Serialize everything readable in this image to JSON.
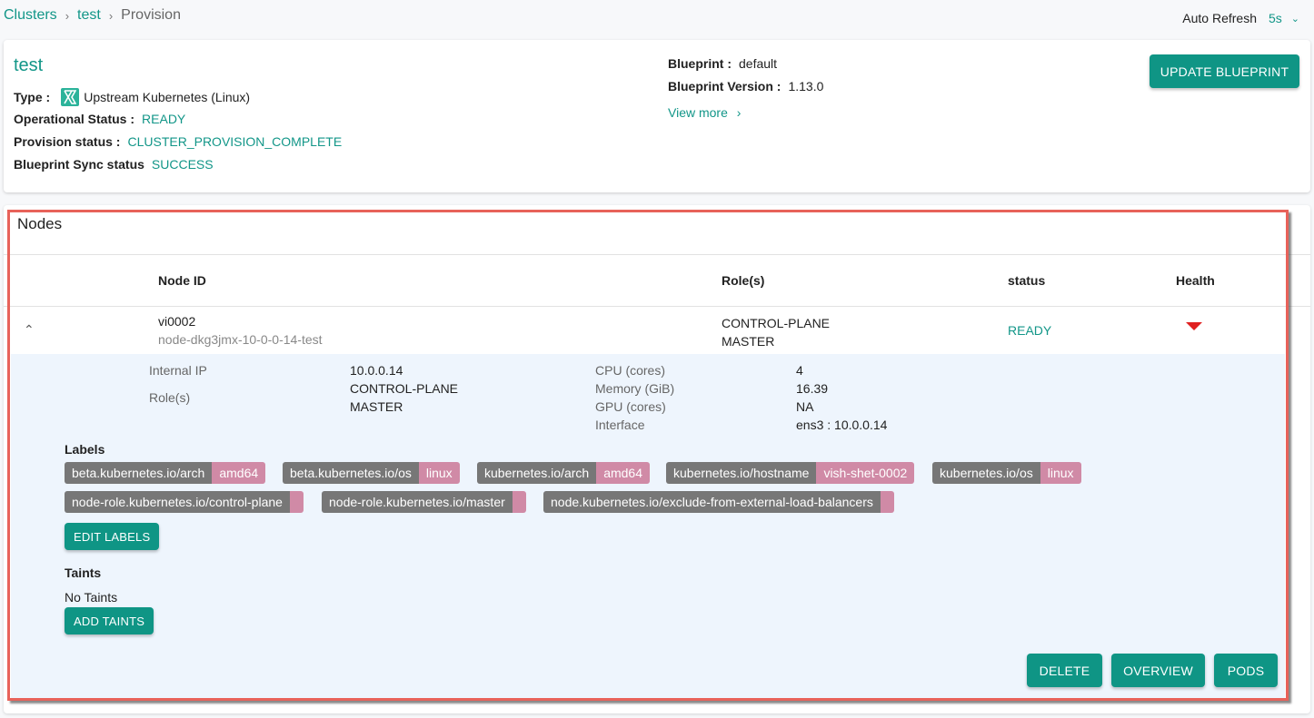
{
  "breadcrumb": [
    {
      "label": "Clusters",
      "link": true
    },
    {
      "label": "test",
      "link": true
    },
    {
      "label": "Provision",
      "link": false
    }
  ],
  "breadcrumb_separator": "›",
  "auto_refresh": {
    "label": "Auto Refresh",
    "value": "5s"
  },
  "cluster": {
    "name": "test",
    "type_label": "Type :",
    "type_value": "Upstream Kubernetes (Linux)",
    "operational_label": "Operational Status :",
    "operational_value": "READY",
    "provision_label": "Provision status :",
    "provision_value": "CLUSTER_PROVISION_COMPLETE",
    "sync_label": "Blueprint Sync status",
    "sync_value": "SUCCESS",
    "blueprint_label": "Blueprint :",
    "blueprint_value": "default",
    "blueprint_version_label": "Blueprint Version :",
    "blueprint_version_value": "1.13.0",
    "view_more": "View more",
    "update_button": "UPDATE BLUEPRINT"
  },
  "nodes": {
    "title": "Nodes",
    "columns": [
      "Node ID",
      "Role(s)",
      "status",
      "Health"
    ],
    "rows": [
      {
        "name": "vi0002",
        "id": "node-dkg3jmx-10-0-0-14-test",
        "roles": [
          "CONTROL-PLANE",
          "MASTER"
        ],
        "status": "READY",
        "health": "down"
      }
    ],
    "detail": {
      "internal_ip_label": "Internal IP",
      "internal_ip": "10.0.0.14",
      "roles_label": "Role(s)",
      "roles": [
        "CONTROL-PLANE",
        "MASTER"
      ],
      "cpu_label": "CPU (cores)",
      "cpu": "4",
      "memory_label": "Memory (GiB)",
      "memory": "16.39",
      "gpu_label": "GPU (cores)",
      "gpu": "NA",
      "interface_label": "Interface",
      "interface": "ens3 : 10.0.0.14",
      "labels_title": "Labels",
      "labels": [
        {
          "key": "beta.kubernetes.io/arch",
          "value": "amd64"
        },
        {
          "key": "beta.kubernetes.io/os",
          "value": "linux"
        },
        {
          "key": "kubernetes.io/arch",
          "value": "amd64"
        },
        {
          "key": "kubernetes.io/hostname",
          "value": "vish-shet-0002"
        },
        {
          "key": "kubernetes.io/os",
          "value": "linux"
        },
        {
          "key": "node-role.kubernetes.io/control-plane",
          "value": ""
        },
        {
          "key": "node-role.kubernetes.io/master",
          "value": ""
        },
        {
          "key": "node.kubernetes.io/exclude-from-external-load-balancers",
          "value": ""
        }
      ],
      "edit_labels": "EDIT LABELS",
      "taints_title": "Taints",
      "no_taints": "No Taints",
      "add_taints": "ADD TAINTS",
      "delete": "DELETE",
      "overview": "OVERVIEW",
      "pods": "PODS"
    }
  },
  "colors": {
    "accent": "#129688",
    "button": "#0f9585",
    "health_down": "#e02020",
    "label_key": "#777777",
    "label_value": "#d08aa6",
    "highlight": "#e8625a"
  }
}
